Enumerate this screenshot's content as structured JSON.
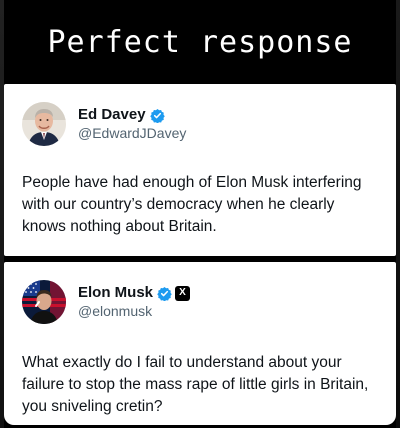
{
  "headline": "Perfect response",
  "tweets": [
    {
      "display_name": "Ed Davey",
      "handle": "@EdwardJDavey",
      "text": "People have had enough of Elon Musk interfering with our country’s democracy when he clearly knows nothing about Britain.",
      "badge": "verified-blue"
    },
    {
      "display_name": "Elon Musk",
      "handle": "@elonmusk",
      "text": "What exactly do I fail to understand about your failure to stop the mass rape of little girls in Britain, you sniveling cretin?",
      "badge": "verified-blue",
      "affiliation_badge": "X"
    }
  ],
  "colors": {
    "background": "#000000",
    "card": "#ffffff",
    "text": "#0f1419",
    "handle": "#536471",
    "verified": "#1d9bf0"
  }
}
